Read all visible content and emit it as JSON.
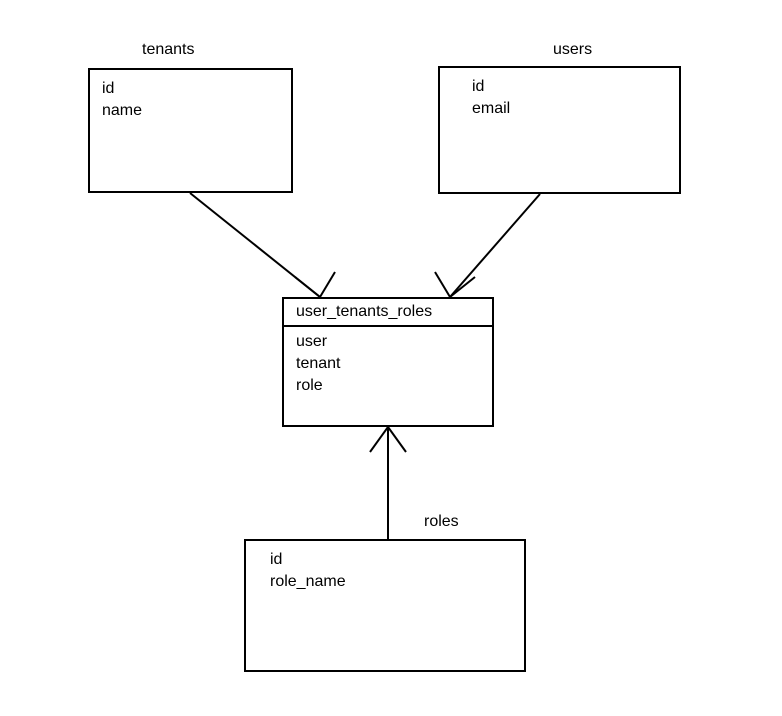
{
  "entities": {
    "tenants": {
      "label": "tenants",
      "fields": [
        "id",
        "name"
      ]
    },
    "users": {
      "label": "users",
      "fields": [
        "id",
        "email"
      ]
    },
    "user_tenants_roles": {
      "label": "user_tenants_roles",
      "fields": [
        "user",
        "tenant",
        "role"
      ]
    },
    "roles": {
      "label": "roles",
      "fields": [
        "id",
        "role_name"
      ]
    }
  }
}
